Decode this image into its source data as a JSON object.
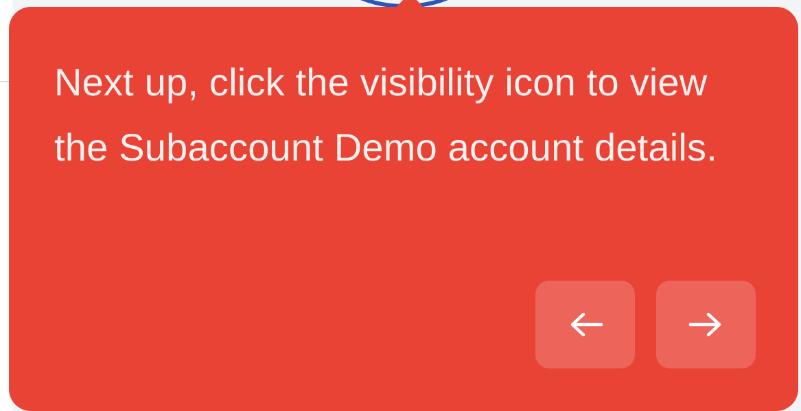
{
  "tooltip": {
    "text": "Next up, click the visibility icon to view the Subaccount Demo account details.",
    "back_icon": "arrow-left-icon",
    "next_icon": "arrow-right-icon"
  },
  "colors": {
    "tooltip_background": "#e94336",
    "tooltip_text": "#fdf1ef",
    "highlight_ring": "#2b55b8"
  }
}
